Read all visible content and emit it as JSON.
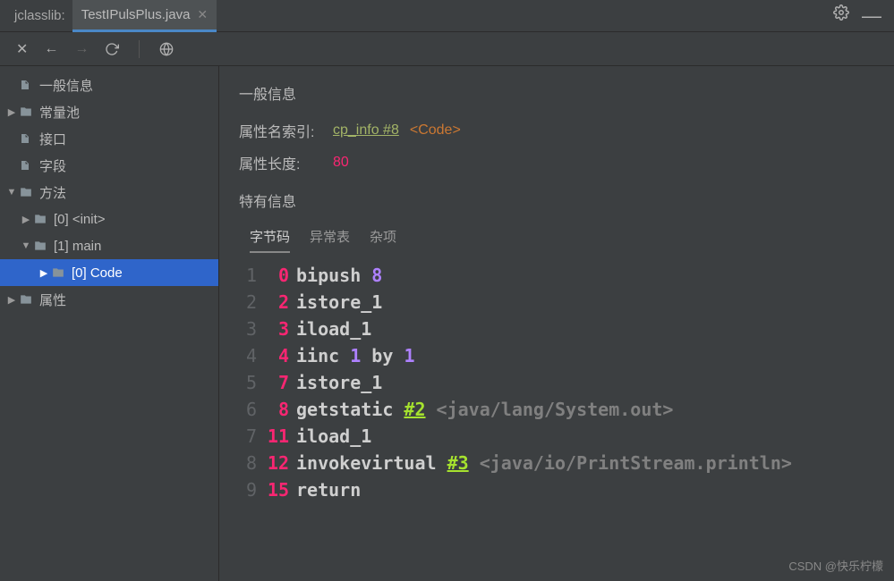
{
  "app_name": "jclasslib:",
  "tab": {
    "title": "TestIPulsPlus.java"
  },
  "tree": {
    "items": [
      {
        "label": "一般信息",
        "depth": 0,
        "arrow": "none",
        "icon": "file"
      },
      {
        "label": "常量池",
        "depth": 0,
        "arrow": "right",
        "icon": "folder"
      },
      {
        "label": "接口",
        "depth": 0,
        "arrow": "none",
        "icon": "file"
      },
      {
        "label": "字段",
        "depth": 0,
        "arrow": "none",
        "icon": "file"
      },
      {
        "label": "方法",
        "depth": 0,
        "arrow": "down",
        "icon": "folder"
      },
      {
        "label": "[0] <init>",
        "depth": 1,
        "arrow": "right",
        "icon": "folder"
      },
      {
        "label": "[1] main",
        "depth": 1,
        "arrow": "down",
        "icon": "folder"
      },
      {
        "label": "[0] Code",
        "depth": 2,
        "arrow": "right",
        "icon": "folder",
        "selected": true
      },
      {
        "label": "属性",
        "depth": 0,
        "arrow": "right",
        "icon": "folder"
      }
    ]
  },
  "panel": {
    "general_info": "一般信息",
    "attr_name_label": "属性名索引:",
    "cp_link": "cp_info #8",
    "code_tag": "<Code>",
    "attr_len_label": "属性长度:",
    "attr_len_value": "80",
    "specific_info": "特有信息",
    "tabs": {
      "bytecode": "字节码",
      "exception": "异常表",
      "misc": "杂项"
    }
  },
  "bytecode": [
    {
      "ln": "1",
      "pc": "0",
      "parts": [
        {
          "t": "op",
          "v": "bipush "
        },
        {
          "t": "num",
          "v": "8"
        }
      ]
    },
    {
      "ln": "2",
      "pc": "2",
      "parts": [
        {
          "t": "op",
          "v": "istore_1"
        }
      ]
    },
    {
      "ln": "3",
      "pc": "3",
      "parts": [
        {
          "t": "op",
          "v": "iload_1"
        }
      ]
    },
    {
      "ln": "4",
      "pc": "4",
      "parts": [
        {
          "t": "op",
          "v": "iinc "
        },
        {
          "t": "num",
          "v": "1"
        },
        {
          "t": "by",
          "v": " by "
        },
        {
          "t": "num",
          "v": "1"
        }
      ]
    },
    {
      "ln": "5",
      "pc": "7",
      "parts": [
        {
          "t": "op",
          "v": "istore_1"
        }
      ]
    },
    {
      "ln": "6",
      "pc": "8",
      "parts": [
        {
          "t": "op",
          "v": "getstatic "
        },
        {
          "t": "ref",
          "v": "#2"
        },
        {
          "t": "cmt",
          "v": " <java/lang/System.out>"
        }
      ]
    },
    {
      "ln": "7",
      "pc": "11",
      "parts": [
        {
          "t": "op",
          "v": "iload_1"
        }
      ]
    },
    {
      "ln": "8",
      "pc": "12",
      "parts": [
        {
          "t": "op",
          "v": "invokevirtual "
        },
        {
          "t": "ref",
          "v": "#3"
        },
        {
          "t": "cmt",
          "v": " <java/io/PrintStream.println>"
        }
      ]
    },
    {
      "ln": "9",
      "pc": "15",
      "parts": [
        {
          "t": "op",
          "v": "return"
        }
      ]
    }
  ],
  "watermark": "CSDN @快乐柠檬"
}
